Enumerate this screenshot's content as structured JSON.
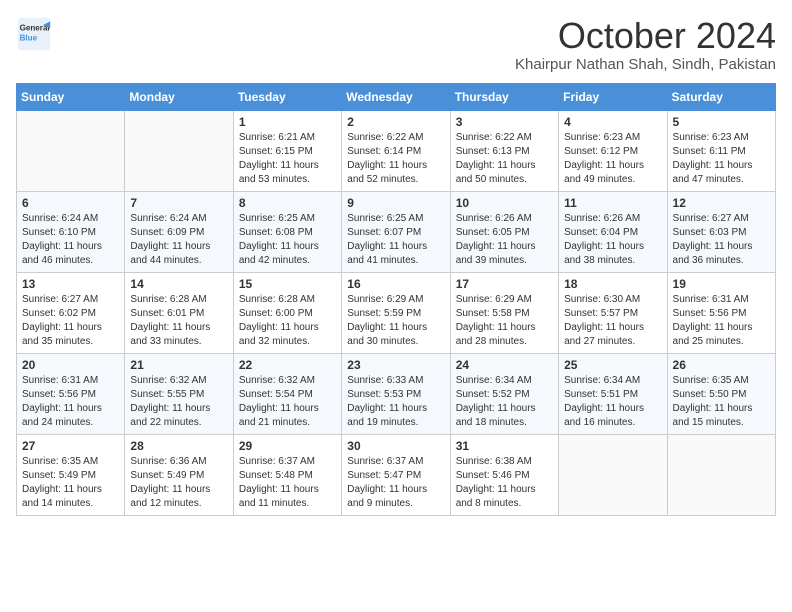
{
  "header": {
    "logo_line1": "General",
    "logo_line2": "Blue",
    "month": "October 2024",
    "location": "Khairpur Nathan Shah, Sindh, Pakistan"
  },
  "weekdays": [
    "Sunday",
    "Monday",
    "Tuesday",
    "Wednesday",
    "Thursday",
    "Friday",
    "Saturday"
  ],
  "weeks": [
    [
      {
        "day": "",
        "info": ""
      },
      {
        "day": "",
        "info": ""
      },
      {
        "day": "1",
        "info": "Sunrise: 6:21 AM\nSunset: 6:15 PM\nDaylight: 11 hours and 53 minutes."
      },
      {
        "day": "2",
        "info": "Sunrise: 6:22 AM\nSunset: 6:14 PM\nDaylight: 11 hours and 52 minutes."
      },
      {
        "day": "3",
        "info": "Sunrise: 6:22 AM\nSunset: 6:13 PM\nDaylight: 11 hours and 50 minutes."
      },
      {
        "day": "4",
        "info": "Sunrise: 6:23 AM\nSunset: 6:12 PM\nDaylight: 11 hours and 49 minutes."
      },
      {
        "day": "5",
        "info": "Sunrise: 6:23 AM\nSunset: 6:11 PM\nDaylight: 11 hours and 47 minutes."
      }
    ],
    [
      {
        "day": "6",
        "info": "Sunrise: 6:24 AM\nSunset: 6:10 PM\nDaylight: 11 hours and 46 minutes."
      },
      {
        "day": "7",
        "info": "Sunrise: 6:24 AM\nSunset: 6:09 PM\nDaylight: 11 hours and 44 minutes."
      },
      {
        "day": "8",
        "info": "Sunrise: 6:25 AM\nSunset: 6:08 PM\nDaylight: 11 hours and 42 minutes."
      },
      {
        "day": "9",
        "info": "Sunrise: 6:25 AM\nSunset: 6:07 PM\nDaylight: 11 hours and 41 minutes."
      },
      {
        "day": "10",
        "info": "Sunrise: 6:26 AM\nSunset: 6:05 PM\nDaylight: 11 hours and 39 minutes."
      },
      {
        "day": "11",
        "info": "Sunrise: 6:26 AM\nSunset: 6:04 PM\nDaylight: 11 hours and 38 minutes."
      },
      {
        "day": "12",
        "info": "Sunrise: 6:27 AM\nSunset: 6:03 PM\nDaylight: 11 hours and 36 minutes."
      }
    ],
    [
      {
        "day": "13",
        "info": "Sunrise: 6:27 AM\nSunset: 6:02 PM\nDaylight: 11 hours and 35 minutes."
      },
      {
        "day": "14",
        "info": "Sunrise: 6:28 AM\nSunset: 6:01 PM\nDaylight: 11 hours and 33 minutes."
      },
      {
        "day": "15",
        "info": "Sunrise: 6:28 AM\nSunset: 6:00 PM\nDaylight: 11 hours and 32 minutes."
      },
      {
        "day": "16",
        "info": "Sunrise: 6:29 AM\nSunset: 5:59 PM\nDaylight: 11 hours and 30 minutes."
      },
      {
        "day": "17",
        "info": "Sunrise: 6:29 AM\nSunset: 5:58 PM\nDaylight: 11 hours and 28 minutes."
      },
      {
        "day": "18",
        "info": "Sunrise: 6:30 AM\nSunset: 5:57 PM\nDaylight: 11 hours and 27 minutes."
      },
      {
        "day": "19",
        "info": "Sunrise: 6:31 AM\nSunset: 5:56 PM\nDaylight: 11 hours and 25 minutes."
      }
    ],
    [
      {
        "day": "20",
        "info": "Sunrise: 6:31 AM\nSunset: 5:56 PM\nDaylight: 11 hours and 24 minutes."
      },
      {
        "day": "21",
        "info": "Sunrise: 6:32 AM\nSunset: 5:55 PM\nDaylight: 11 hours and 22 minutes."
      },
      {
        "day": "22",
        "info": "Sunrise: 6:32 AM\nSunset: 5:54 PM\nDaylight: 11 hours and 21 minutes."
      },
      {
        "day": "23",
        "info": "Sunrise: 6:33 AM\nSunset: 5:53 PM\nDaylight: 11 hours and 19 minutes."
      },
      {
        "day": "24",
        "info": "Sunrise: 6:34 AM\nSunset: 5:52 PM\nDaylight: 11 hours and 18 minutes."
      },
      {
        "day": "25",
        "info": "Sunrise: 6:34 AM\nSunset: 5:51 PM\nDaylight: 11 hours and 16 minutes."
      },
      {
        "day": "26",
        "info": "Sunrise: 6:35 AM\nSunset: 5:50 PM\nDaylight: 11 hours and 15 minutes."
      }
    ],
    [
      {
        "day": "27",
        "info": "Sunrise: 6:35 AM\nSunset: 5:49 PM\nDaylight: 11 hours and 14 minutes."
      },
      {
        "day": "28",
        "info": "Sunrise: 6:36 AM\nSunset: 5:49 PM\nDaylight: 11 hours and 12 minutes."
      },
      {
        "day": "29",
        "info": "Sunrise: 6:37 AM\nSunset: 5:48 PM\nDaylight: 11 hours and 11 minutes."
      },
      {
        "day": "30",
        "info": "Sunrise: 6:37 AM\nSunset: 5:47 PM\nDaylight: 11 hours and 9 minutes."
      },
      {
        "day": "31",
        "info": "Sunrise: 6:38 AM\nSunset: 5:46 PM\nDaylight: 11 hours and 8 minutes."
      },
      {
        "day": "",
        "info": ""
      },
      {
        "day": "",
        "info": ""
      }
    ]
  ]
}
